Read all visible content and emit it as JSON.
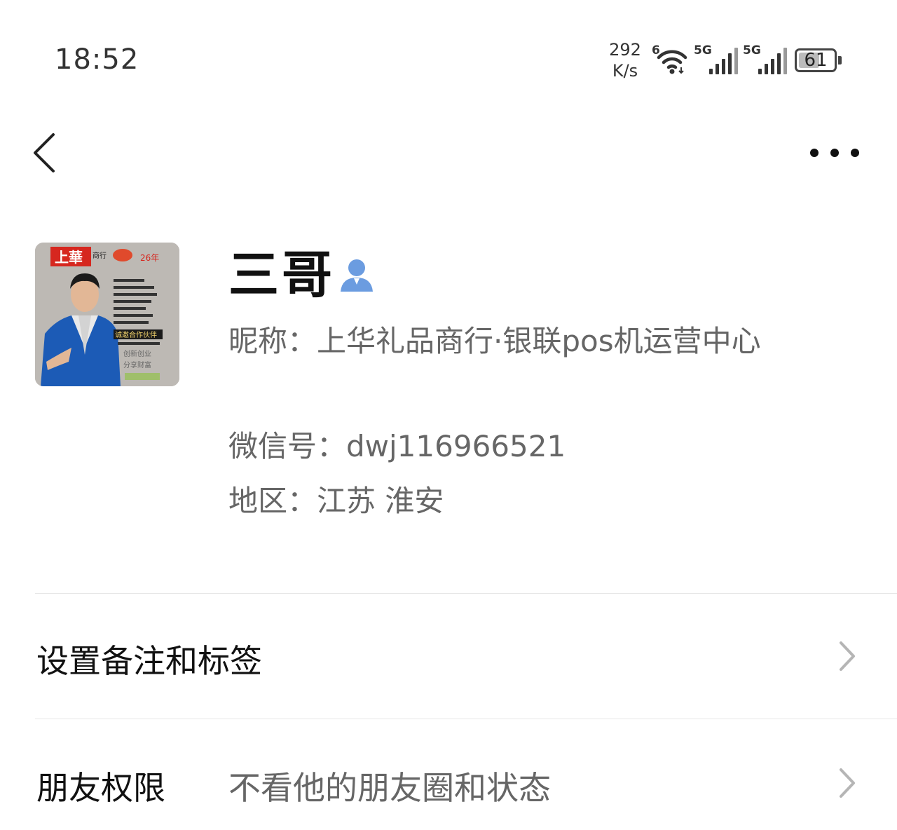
{
  "status_bar": {
    "time": "18:52",
    "speed_value": "292",
    "speed_unit": "K/s",
    "wifi_badge": "6",
    "sim1_badge": "5G",
    "sim2_badge": "5G",
    "battery": "61",
    "battery_level_percent": 61
  },
  "header": {
    "back_icon": "chevron-left-icon",
    "more_icon": "more-dots-icon"
  },
  "profile": {
    "name": "三哥",
    "nickname": "昵称：上华礼品商行·银联pos机运营中心",
    "wechat_id": "微信号：dwj116966521",
    "region": "地区：江苏  淮安",
    "avatar_text": {
      "brand": "上華",
      "brand_sub": "商行",
      "years": "26年",
      "lines": [
        "诚邀合作伙伴",
        "创新创业",
        "分享财富"
      ]
    },
    "avatar_colors": {
      "brand_red": "#d6271f",
      "suit_blue": "#1c5bb6",
      "background": "#bdb9b4"
    },
    "contact_icon_color": "#6b9ce0"
  },
  "menu": {
    "remarks": {
      "label": "设置备注和标签"
    },
    "permissions": {
      "label": "朋友权限",
      "value": "不看他的朋友圈和状态"
    }
  }
}
